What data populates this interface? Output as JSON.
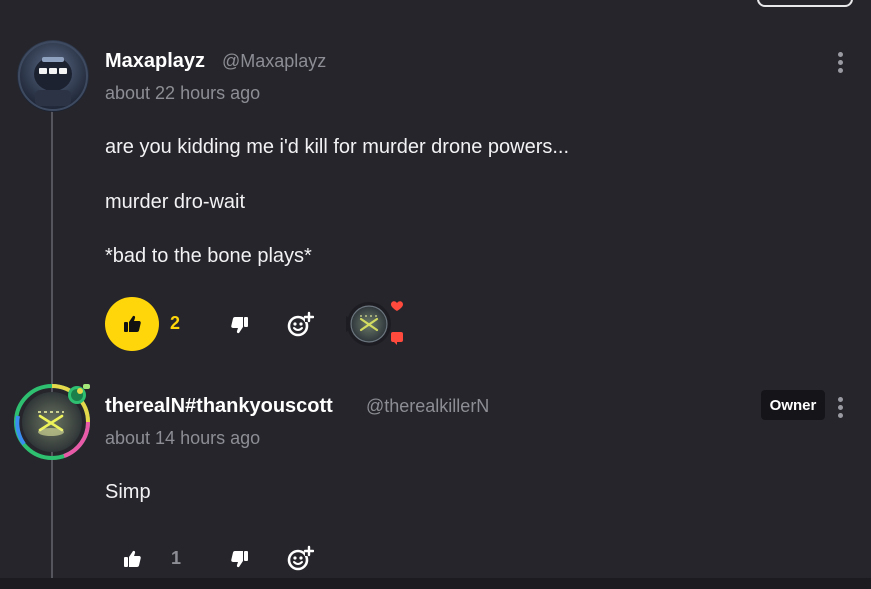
{
  "colors": {
    "background": "#25252b",
    "accent_yellow": "#ffd60a",
    "muted_text": "#8d8d95",
    "heart_red": "#ff4a3d"
  },
  "comments": [
    {
      "username": "Maxaplayz",
      "handle": "@Maxaplayz",
      "timestamp": "about 22 hours ago",
      "body": [
        "are you kidding me i'd kill for murder drone powers...",
        "murder dro-wait",
        "*bad to the bone plays*"
      ],
      "likes": "2",
      "liked": true,
      "icons": {
        "like": "thumbs-up-icon",
        "dislike": "thumbs-down-icon",
        "react": "add-reaction-icon",
        "menu": "kebab-menu-icon"
      },
      "reactor_badges": [
        "heart-icon",
        "speech-bubble-icon"
      ]
    },
    {
      "username": "therealN#thankyouscott",
      "handle": "@therealkillerN",
      "timestamp": "about 14 hours ago",
      "badge": "Owner",
      "body": [
        "Simp"
      ],
      "likes": "1",
      "liked": false,
      "icons": {
        "like": "thumbs-up-icon",
        "dislike": "thumbs-down-icon",
        "react": "add-reaction-icon",
        "menu": "kebab-menu-icon"
      }
    }
  ]
}
